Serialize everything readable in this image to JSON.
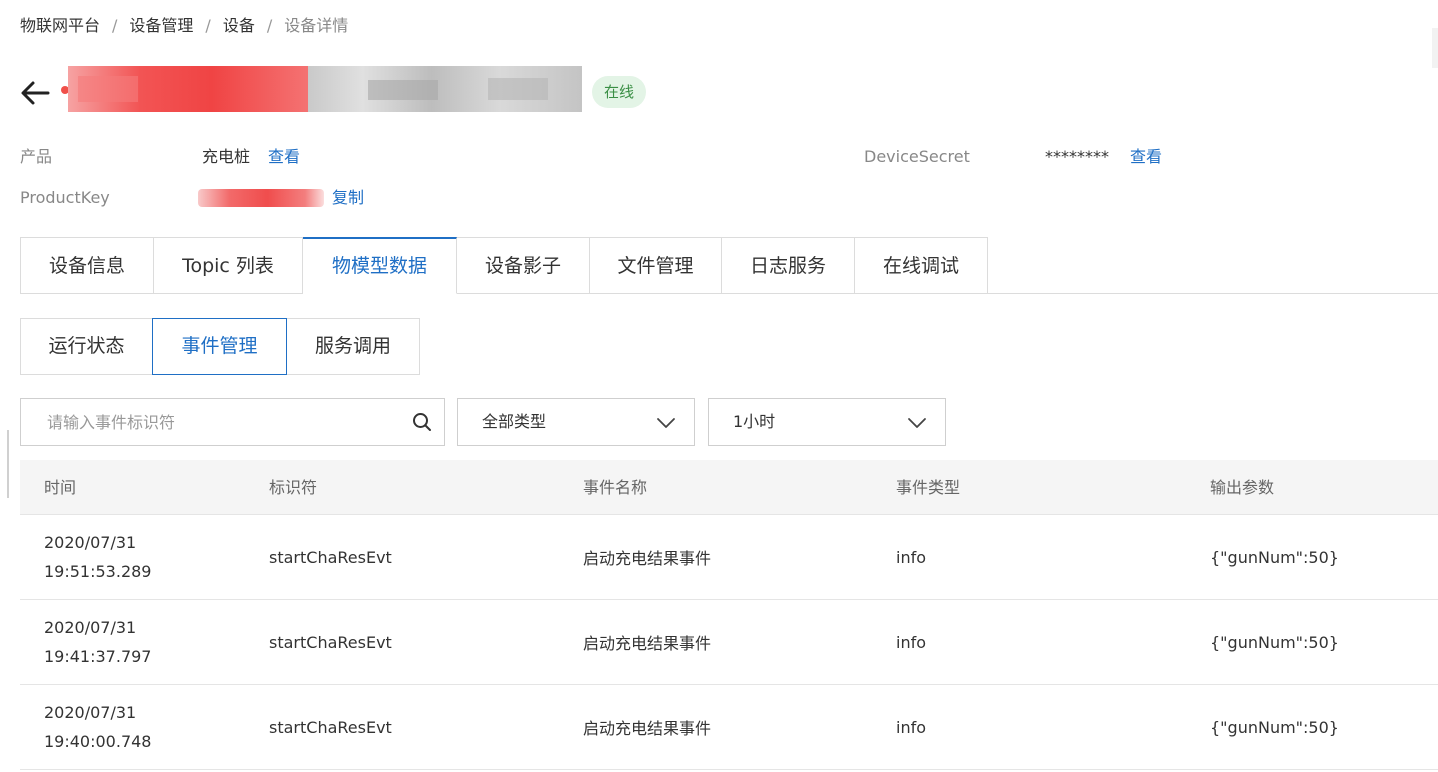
{
  "breadcrumb": {
    "items": [
      "物联网平台",
      "设备管理",
      "设备",
      "设备详情"
    ],
    "separator": "/"
  },
  "device": {
    "status": "在线",
    "status_color": "#3a8f45"
  },
  "meta": {
    "product_label": "产品",
    "product_value": "充电桩",
    "product_link": "查看",
    "productkey_label": "ProductKey",
    "productkey_copy": "复制",
    "secret_label": "DeviceSecret",
    "secret_value": "********",
    "secret_link": "查看"
  },
  "tabs": [
    "设备信息",
    "Topic 列表",
    "物模型数据",
    "设备影子",
    "文件管理",
    "日志服务",
    "在线调试"
  ],
  "active_tab": "物模型数据",
  "subtabs": [
    "运行状态",
    "事件管理",
    "服务调用"
  ],
  "active_subtab": "事件管理",
  "filters": {
    "search_placeholder": "请输入事件标识符",
    "type_select": "全部类型",
    "time_select": "1小时"
  },
  "table": {
    "columns": [
      "时间",
      "标识符",
      "事件名称",
      "事件类型",
      "输出参数"
    ],
    "rows": [
      {
        "date": "2020/07/31",
        "time": "19:51:53.289",
        "identifier": "startChaResEvt",
        "name": "启动充电结果事件",
        "type": "info",
        "output": "{\"gunNum\":50}"
      },
      {
        "date": "2020/07/31",
        "time": "19:41:37.797",
        "identifier": "startChaResEvt",
        "name": "启动充电结果事件",
        "type": "info",
        "output": "{\"gunNum\":50}"
      },
      {
        "date": "2020/07/31",
        "time": "19:40:00.748",
        "identifier": "startChaResEvt",
        "name": "启动充电结果事件",
        "type": "info",
        "output": "{\"gunNum\":50}"
      }
    ]
  },
  "colors": {
    "accent": "#1f6fc5",
    "status_bg": "#e3f4e6"
  }
}
